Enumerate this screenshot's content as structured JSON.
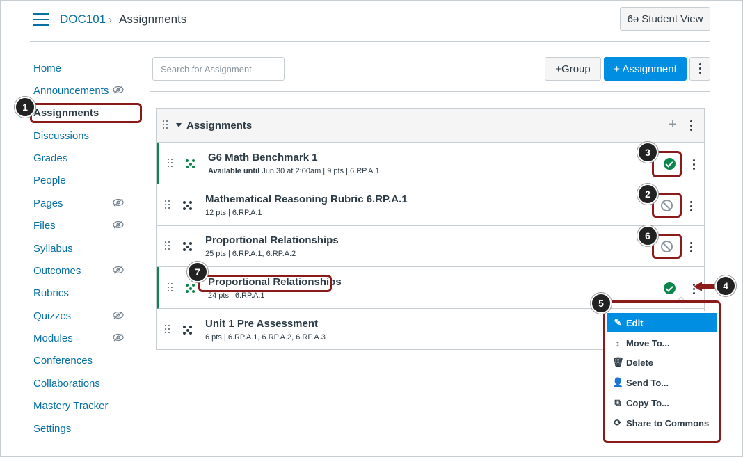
{
  "header": {
    "course": "DOC101",
    "separator": "›",
    "page": "Assignments",
    "student_view_icon": "6ə",
    "student_view_label": "Student View"
  },
  "sidebar": {
    "items": [
      {
        "label": "Home",
        "hidden": false
      },
      {
        "label": "Announcements",
        "hidden": true
      },
      {
        "label": "Assignments",
        "hidden": false,
        "active": true
      },
      {
        "label": "Discussions",
        "hidden": false
      },
      {
        "label": "Grades",
        "hidden": false
      },
      {
        "label": "People",
        "hidden": false
      },
      {
        "label": "Pages",
        "hidden": true
      },
      {
        "label": "Files",
        "hidden": true
      },
      {
        "label": "Syllabus",
        "hidden": false
      },
      {
        "label": "Outcomes",
        "hidden": true
      },
      {
        "label": "Rubrics",
        "hidden": false
      },
      {
        "label": "Quizzes",
        "hidden": true
      },
      {
        "label": "Modules",
        "hidden": true
      },
      {
        "label": "Conferences",
        "hidden": false
      },
      {
        "label": "Collaborations",
        "hidden": false
      },
      {
        "label": "Mastery Tracker",
        "hidden": false
      },
      {
        "label": "Settings",
        "hidden": false
      }
    ]
  },
  "toolbar": {
    "search_placeholder": "Search for Assignment",
    "group_label": "+Group",
    "assignment_label": "+ Assignment"
  },
  "group": {
    "title": "Assignments",
    "add": "+",
    "rows": [
      {
        "title": "G6 Math Benchmark 1",
        "meta_bold": "Available until",
        "meta": " Jun 30 at 2:00am  |  9 pts  |  6.RP.A.1",
        "published": true
      },
      {
        "title": "Mathematical Reasoning Rubric 6.RP.A.1",
        "meta_bold": "",
        "meta": "12 pts  |  6.RP.A.1",
        "published": false
      },
      {
        "title": "Proportional Relationships",
        "meta_bold": "",
        "meta": "25 pts  |  6.RP.A.1, 6.RP.A.2",
        "published": false
      },
      {
        "title": "Proportional Relationships",
        "meta_bold": "",
        "meta": "24 pts  |  6.RP.A.1",
        "published": true
      },
      {
        "title": "Unit 1 Pre Assessment",
        "meta_bold": "",
        "meta": "6 pts  |  6.RP.A.1, 6.RP.A.2, 6.RP.A.3",
        "published": null
      }
    ]
  },
  "menu": {
    "items": [
      {
        "label": "Edit",
        "icon": "✎",
        "icon_name": "pencil-icon"
      },
      {
        "label": "Move To...",
        "icon": "↕",
        "icon_name": "move-icon"
      },
      {
        "label": "Delete",
        "icon": "🗑",
        "icon_name": "trash-icon"
      },
      {
        "label": "Send To...",
        "icon": "👤",
        "icon_name": "user-icon"
      },
      {
        "label": "Copy To...",
        "icon": "⧉",
        "icon_name": "copy-icon"
      },
      {
        "label": "Share to Commons",
        "icon": "⟳",
        "icon_name": "commons-icon"
      }
    ]
  },
  "callouts": [
    "1",
    "2",
    "3",
    "4",
    "5",
    "6",
    "7"
  ],
  "colors": {
    "link": "#0770a3",
    "primary_button": "#008ee2",
    "published": "#0b874b",
    "callout_outline": "#8b1a1a"
  }
}
